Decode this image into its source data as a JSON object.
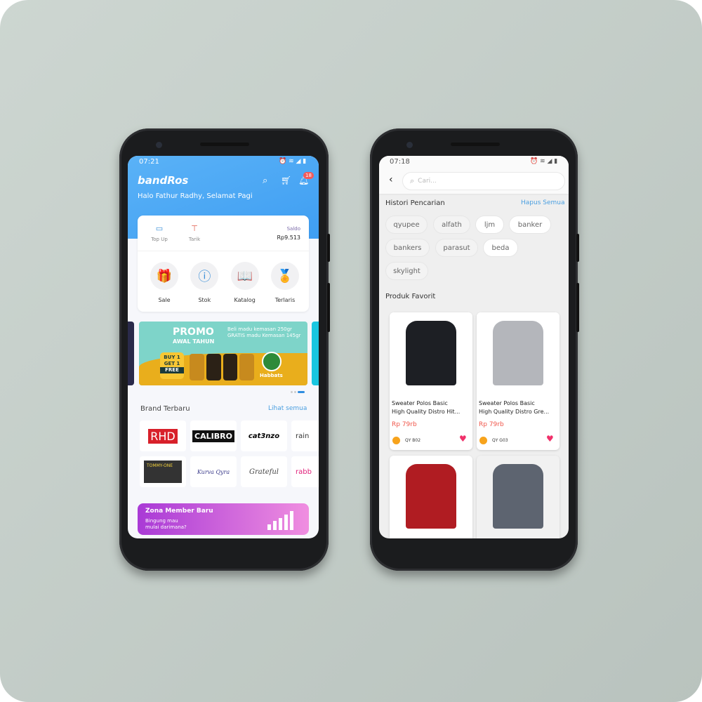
{
  "home": {
    "status_time": "07:21",
    "logo": "bandRos",
    "notification_count": "18",
    "greeting": "Halo Fathur Radhy, Selamat Pagi",
    "wallet": {
      "topup": "Top Up",
      "tarik": "Tarik",
      "saldo_label": "Saldo",
      "saldo_value": "Rp9.513"
    },
    "menu": [
      {
        "label": "Sale",
        "icon": "gift-icon"
      },
      {
        "label": "Stok",
        "icon": "info-icon"
      },
      {
        "label": "Katalog",
        "icon": "book-icon"
      },
      {
        "label": "Terlaris",
        "icon": "award-icon"
      }
    ],
    "banner": {
      "title": "PROMO",
      "subtitle": "AWAL TAHUN",
      "text": "Beli madu kemasan 250gr GRATIS madu Kemasan 145gr",
      "badge1": "BUY 1",
      "badge2": "GET 1",
      "badge3": "FREE",
      "brand": "Habbats"
    },
    "brands_title": "Brand Terbaru",
    "brands_link": "Lihat semua",
    "brands": [
      "RHD",
      "CALIBRO",
      "cat3nzo",
      "rain",
      "TOMMY-ONE",
      "Kurva Qyra",
      "Grateful",
      "rabb"
    ],
    "member": {
      "title": "Zona Member Baru",
      "text1": "Bingung mau",
      "text2": "mulai darimana?"
    },
    "colors": {
      "primary": "#4aa8f4",
      "accent": "#3a8fd8"
    }
  },
  "search": {
    "status_time": "07:18",
    "placeholder": "Cari...",
    "history_title": "Histori Pencarian",
    "clear_all": "Hapus Semua",
    "history": [
      "qyupee",
      "alfath",
      "ljm",
      "banker",
      "bankers",
      "parasut",
      "beda",
      "skylight"
    ],
    "favorites_title": "Produk Favorit",
    "products": [
      {
        "name1": "Sweater Polos Basic",
        "name2": "High Quality Distro Hit...",
        "price": "Rp 79rb",
        "seller": "QY B02",
        "color": "#1d1f24"
      },
      {
        "name1": "Sweater Polos Basic",
        "name2": "High Quality Distro Gre...",
        "price": "Rp 79rb",
        "seller": "QY G03",
        "color": "#b4b6bb"
      },
      {
        "color": "#b01c22"
      },
      {
        "color": "#5d6470"
      }
    ],
    "colors": {
      "link": "#4a9fe0",
      "price": "#f0564a",
      "heart": "#f0306a"
    }
  }
}
